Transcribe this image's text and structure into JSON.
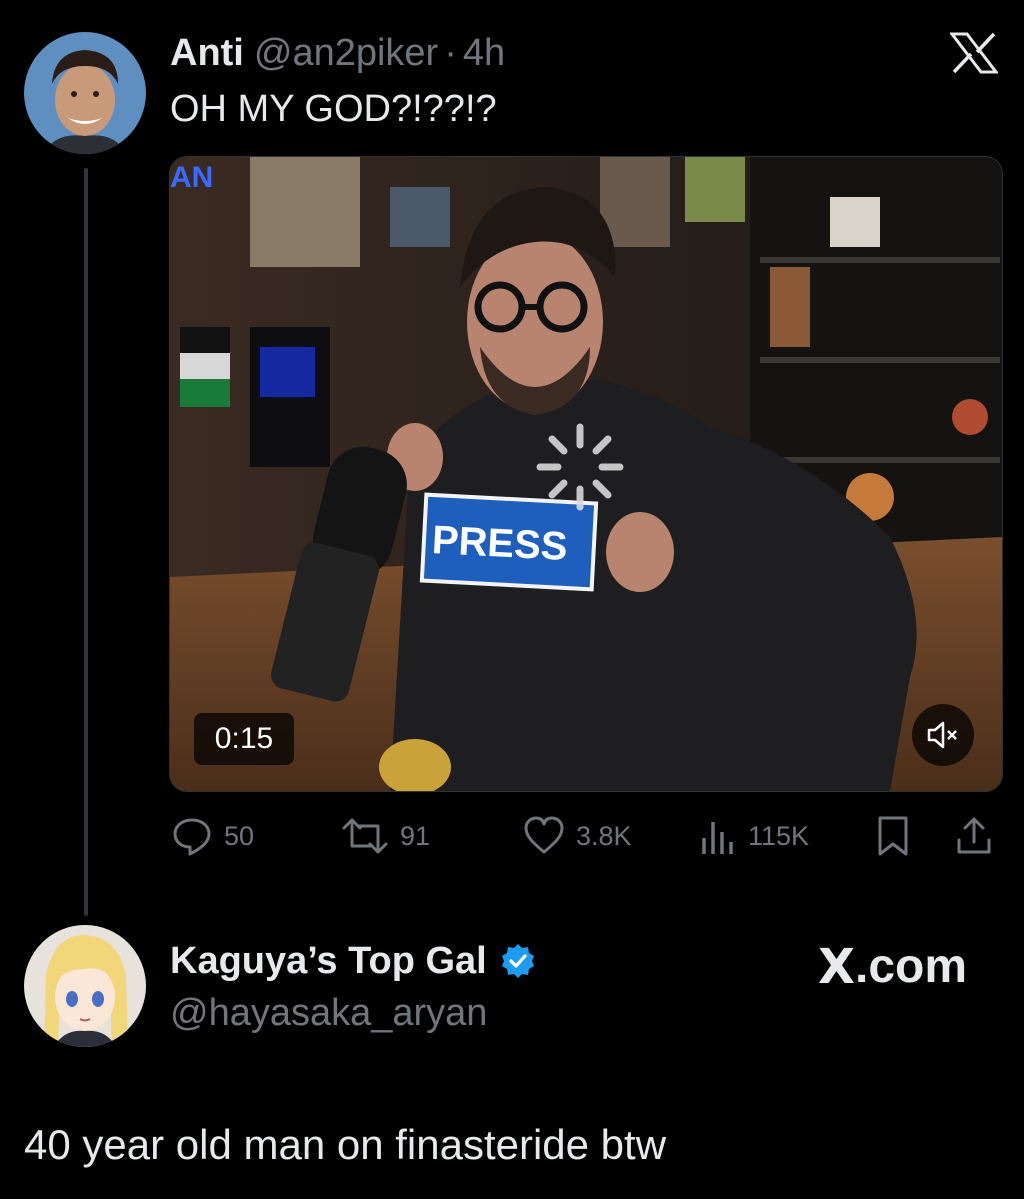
{
  "tweet": {
    "author_name": "Anti",
    "author_handle": "@an2piker",
    "separator": "·",
    "time": "4h",
    "text": "OH MY GOD?!??!?",
    "media": {
      "duration": "0:15",
      "badge_text": "PRESS",
      "muted": true
    },
    "stats": {
      "replies": "50",
      "retweets": "91",
      "likes": "3.8K",
      "views": "115K"
    }
  },
  "reply": {
    "author_name": "Kaguya’s Top Gal",
    "author_handle": "@hayasaka_aryan",
    "verified": true,
    "text": "40 year old man on finasteride btw"
  },
  "branding": {
    "x_logo": "x-logo-icon",
    "site_label": ".com",
    "site_mark": "X"
  },
  "colors": {
    "background": "#000000",
    "primary_text": "#e7e9ea",
    "secondary_text": "#71767b",
    "verified_blue": "#1d9bf0",
    "press_badge": "#1e5fbe"
  }
}
